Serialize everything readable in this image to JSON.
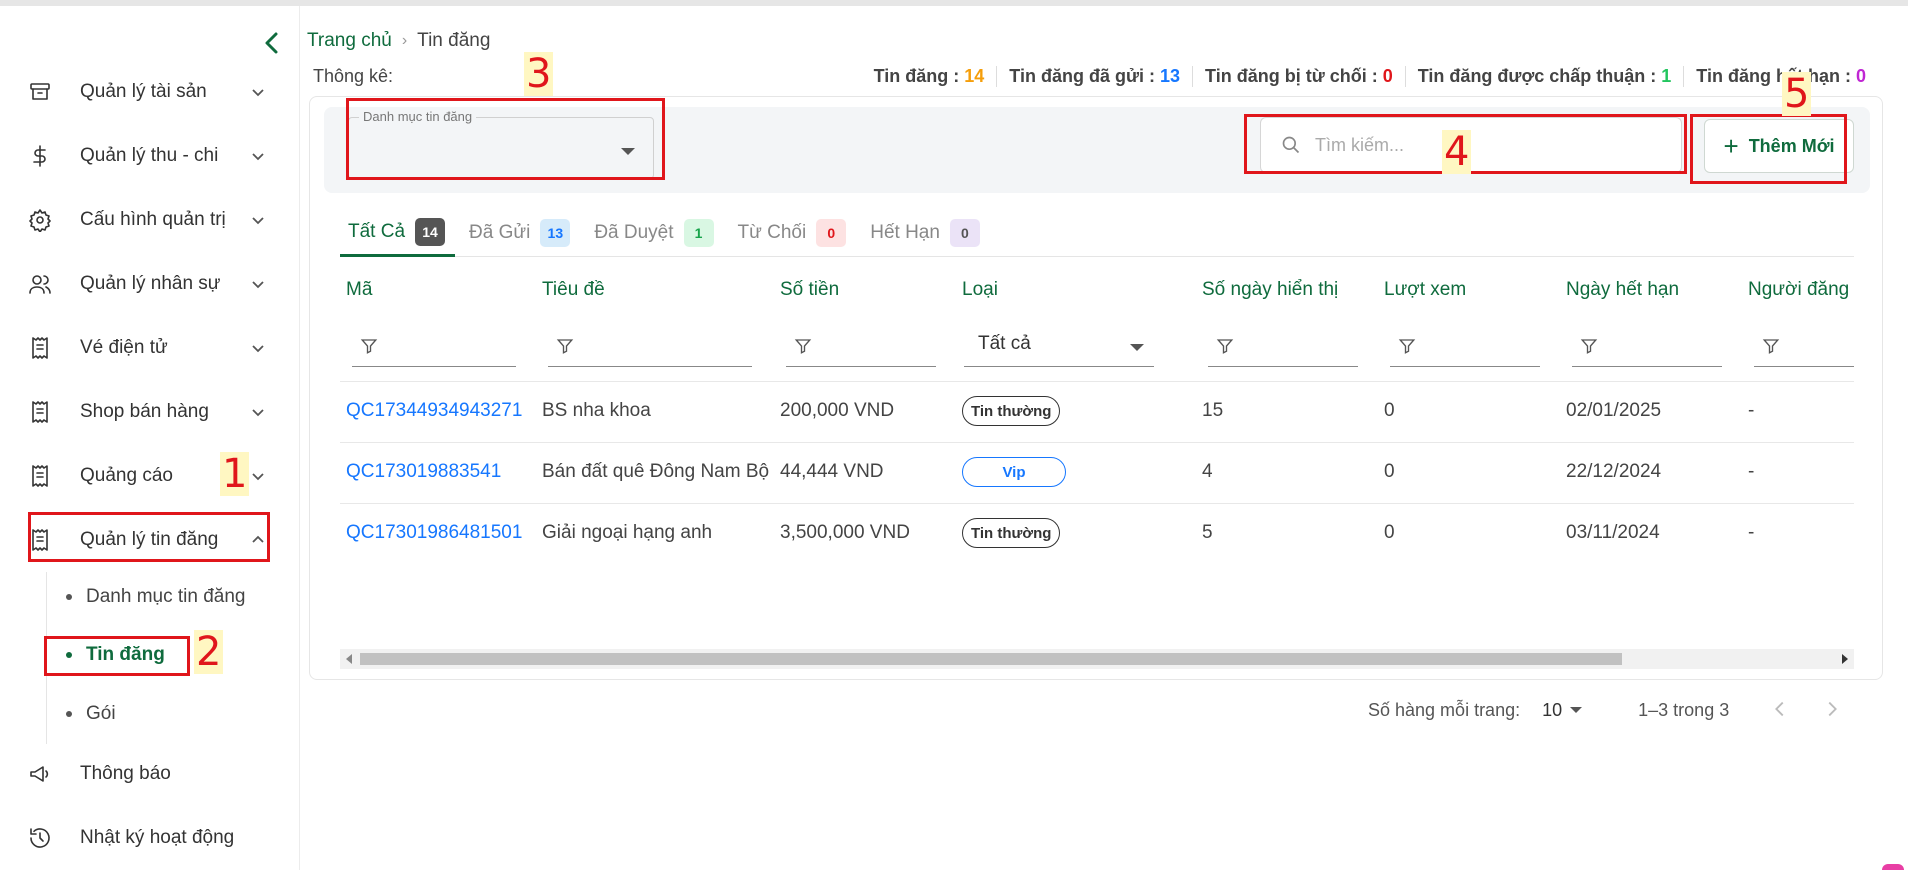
{
  "sidebar": {
    "items": [
      {
        "label": "Quản lý tài sản",
        "icon": "archive-icon"
      },
      {
        "label": "Quản lý thu - chi",
        "icon": "dollar-icon"
      },
      {
        "label": "Cấu hình quản trị",
        "icon": "gear-icon"
      },
      {
        "label": "Quản lý nhân sự",
        "icon": "users-icon"
      },
      {
        "label": "Vé điện tử",
        "icon": "receipt-icon"
      },
      {
        "label": "Shop bán hàng",
        "icon": "receipt-icon"
      },
      {
        "label": "Quảng cáo",
        "icon": "receipt-icon"
      },
      {
        "label": "Quản lý tin đăng",
        "icon": "receipt-icon"
      },
      {
        "label": "Thông báo",
        "icon": "megaphone-icon"
      },
      {
        "label": "Nhật ký hoạt động",
        "icon": "history-icon"
      }
    ],
    "subitems": [
      {
        "label": "Danh mục tin đăng"
      },
      {
        "label": "Tin đăng"
      },
      {
        "label": "Gói"
      }
    ]
  },
  "annotations": [
    "1",
    "2",
    "3",
    "4",
    "5"
  ],
  "breadcrumb": {
    "home": "Trang chủ",
    "current": "Tin đăng"
  },
  "stats": {
    "label": "Thông kê:",
    "items": [
      {
        "label": "Tin đăng :",
        "value": "14",
        "color": "#f59e0b"
      },
      {
        "label": "Tin đăng đã gửi :",
        "value": "13",
        "color": "#1677ff"
      },
      {
        "label": "Tin đăng bị từ chối :",
        "value": "0",
        "color": "#e0161b"
      },
      {
        "label": "Tin đăng được chấp thuận :",
        "value": "1",
        "color": "#22c55e"
      },
      {
        "label": "Tin đăng hết hạn :",
        "value": "0",
        "color": "#c026d3"
      }
    ]
  },
  "filter": {
    "category_label": "Danh mục tin đăng",
    "search_placeholder": "Tìm kiếm...",
    "add_label": "Thêm Mới"
  },
  "tabs": [
    {
      "label": "Tất Cả",
      "count": "14",
      "bg": "#555555",
      "fg": "#ffffff"
    },
    {
      "label": "Đã Gửi",
      "count": "13",
      "bg": "#d6ebfa",
      "fg": "#1677ff"
    },
    {
      "label": "Đã Duyệt",
      "count": "1",
      "bg": "#d9f7e3",
      "fg": "#16a34a"
    },
    {
      "label": "Từ Chối",
      "count": "0",
      "bg": "#fde2e2",
      "fg": "#e0161b"
    },
    {
      "label": "Hết Hạn",
      "count": "0",
      "bg": "#ebe3f7",
      "fg": "#555555"
    }
  ],
  "table": {
    "columns": [
      "Mã",
      "Tiêu đề",
      "Số tiền",
      "Loại",
      "Số ngày hiển thị",
      "Lượt xem",
      "Ngày hết hạn",
      "Người đăng"
    ],
    "type_filter_value": "Tất cả",
    "rows": [
      {
        "code": "QC17344934943271",
        "title": "BS nha khoa",
        "amount": "200,000 VND",
        "type": "Tin thường",
        "days": "15",
        "views": "0",
        "expiry": "02/01/2025",
        "author": "-"
      },
      {
        "code": "QC173019883541",
        "title": "Bán đất quê Đông Nam Bộ",
        "amount": "44,444 VND",
        "type": "Vip",
        "days": "4",
        "views": "0",
        "expiry": "22/12/2024",
        "author": "-"
      },
      {
        "code": "QC17301986481501",
        "title": "Giải ngoại hạng anh",
        "amount": "3,500,000 VND",
        "type": "Tin thường",
        "days": "5",
        "views": "0",
        "expiry": "03/11/2024",
        "author": "-"
      }
    ]
  },
  "pagination": {
    "rows_per_page_label": "Số hàng mỗi trang:",
    "rows_per_page": "10",
    "range": "1–3 trong 3"
  },
  "colors": {
    "brand": "#0f6b3d",
    "link": "#1677ff",
    "annotation": "#e0161b"
  }
}
